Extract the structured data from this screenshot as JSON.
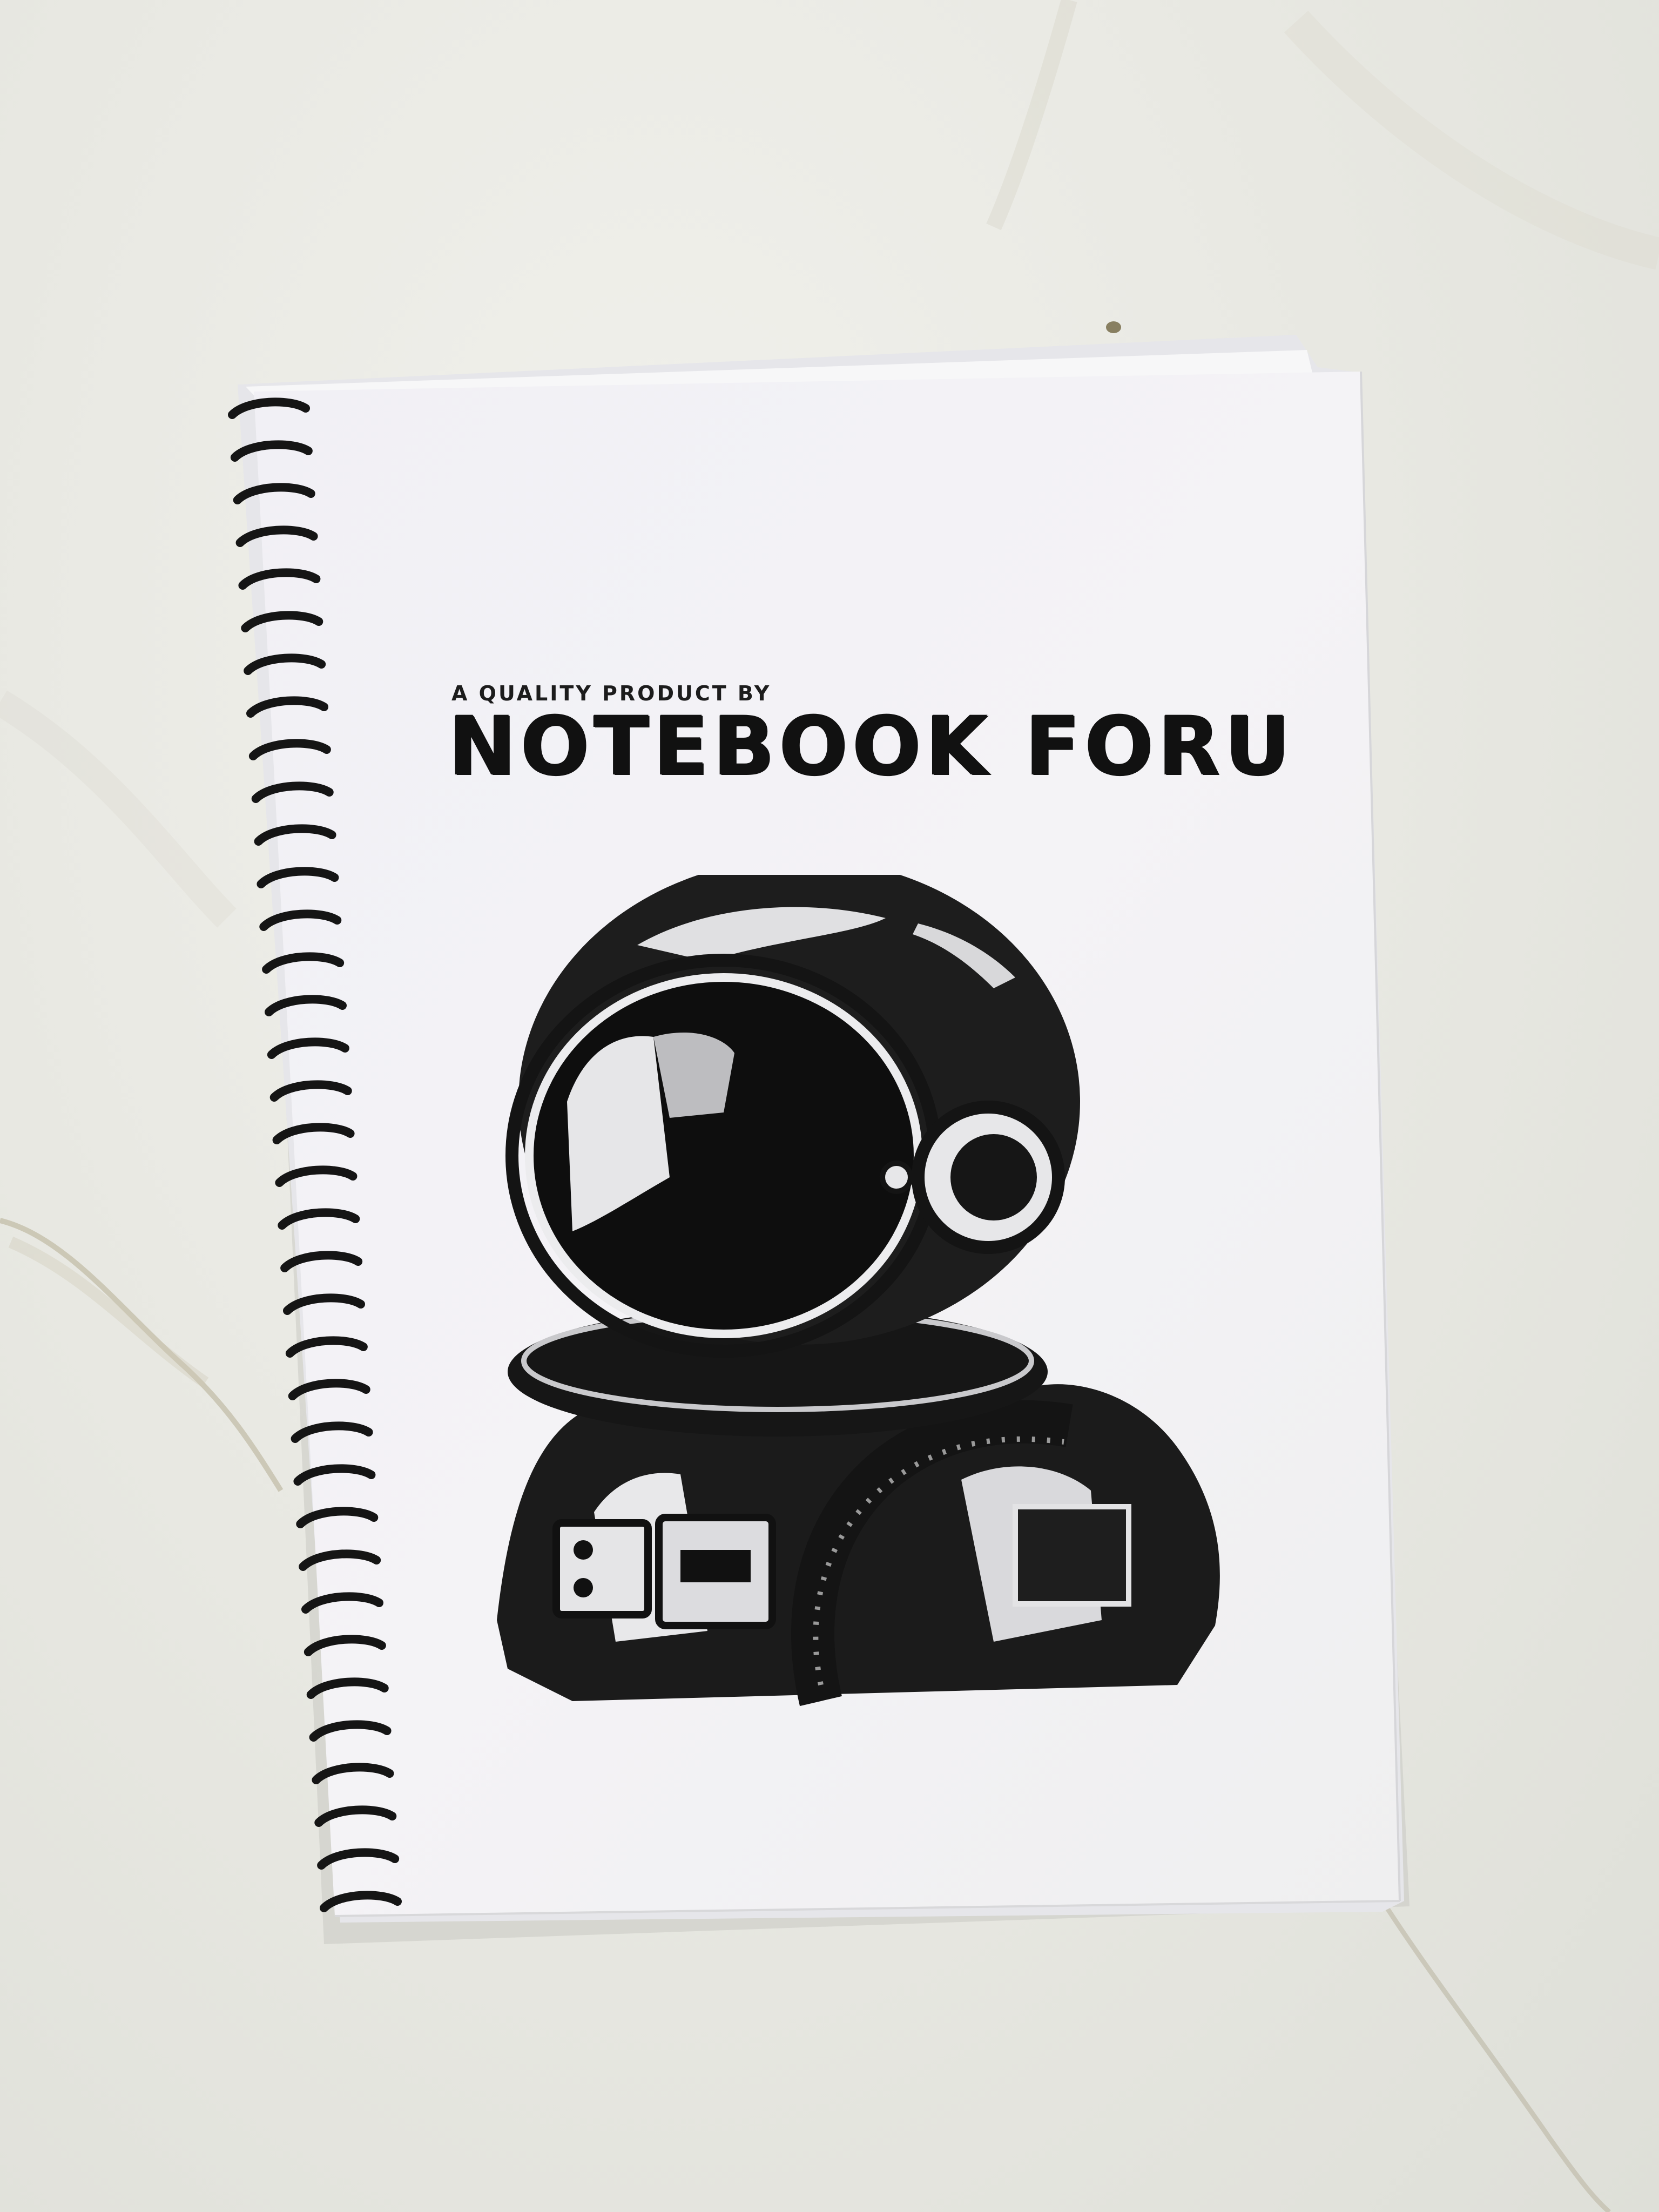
{
  "cover": {
    "tagline": "A QUALITY PRODUCT BY",
    "brand": "NOTEBOOK FORU"
  },
  "illustration": {
    "subject": "astronaut-icon"
  },
  "colors": {
    "surface": "#e9e9e3",
    "paper": "#f3f3f4",
    "ink": "#111111",
    "binding": "#151515"
  }
}
